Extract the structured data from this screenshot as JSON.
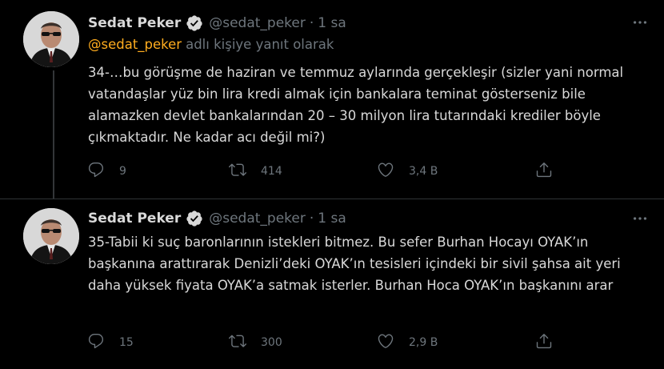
{
  "accent_color": "#ffad1f",
  "verified_color": "#d9d9d9",
  "tweets": [
    {
      "author_name": "Sedat Peker",
      "handle": "@sedat_peker",
      "separator": "·",
      "time": "1 sa",
      "reply_to_mention": "@sedat_peker",
      "reply_to_text": "adlı kişiye yanıt olarak",
      "text": "34-…bu görüşme de haziran ve temmuz aylarında gerçekleşir (sizler yani normal vatandaşlar yüz bin lira kredi almak için bankalara teminat gösterseniz bile alamazken devlet bankalarından 20 – 30 milyon lira tutarındaki krediler böyle çıkmaktadır. Ne kadar acı değil mi?)",
      "replies": "9",
      "retweets": "414",
      "likes": "3,4 B",
      "icons": [
        "verified-icon",
        "more-icon",
        "reply-icon",
        "retweet-icon",
        "like-icon",
        "share-icon"
      ]
    },
    {
      "author_name": "Sedat Peker",
      "handle": "@sedat_peker",
      "separator": "·",
      "time": "1 sa",
      "text": "35-Tabii ki suç baronlarının istekleri bitmez. Bu sefer Burhan Hocayı OYAK’ın başkanına arattırarak Denizli’deki OYAK’ın tesisleri içindeki bir sivil şahsa ait yeri daha yüksek fiyata OYAK’a satmak isterler. Burhan Hoca OYAK’ın başkanını arar",
      "replies": "15",
      "retweets": "300",
      "likes": "2,9 B",
      "icons": [
        "verified-icon",
        "more-icon",
        "reply-icon",
        "retweet-icon",
        "like-icon",
        "share-icon"
      ]
    }
  ]
}
